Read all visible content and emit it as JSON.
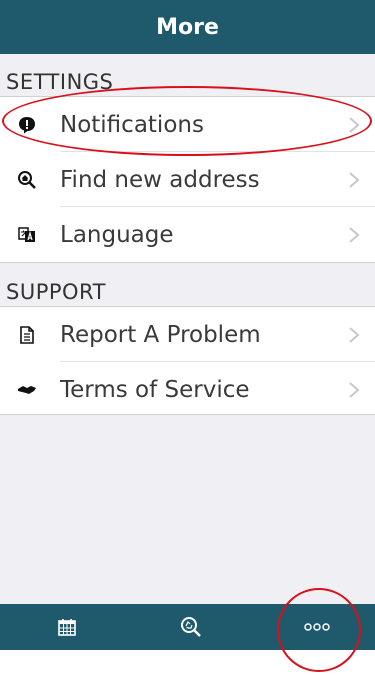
{
  "header": {
    "title": "More"
  },
  "sections": [
    {
      "title": "SETTINGS",
      "items": [
        {
          "label": "Notifications",
          "icon": "notification-bubble-icon"
        },
        {
          "label": "Find new address",
          "icon": "home-search-icon"
        },
        {
          "label": "Language",
          "icon": "translate-icon"
        }
      ]
    },
    {
      "title": "SUPPORT",
      "items": [
        {
          "label": "Report A Problem",
          "icon": "document-icon"
        },
        {
          "label": "Terms of Service",
          "icon": "handshake-icon"
        }
      ]
    }
  ],
  "tabbar": {
    "tabs": [
      {
        "icon": "calendar-icon"
      },
      {
        "icon": "recycle-search-icon"
      },
      {
        "icon": "more-dots-icon"
      }
    ]
  },
  "colors": {
    "brand": "#1e5a6c",
    "annotation": "#d9101a",
    "background": "#efeff4"
  }
}
